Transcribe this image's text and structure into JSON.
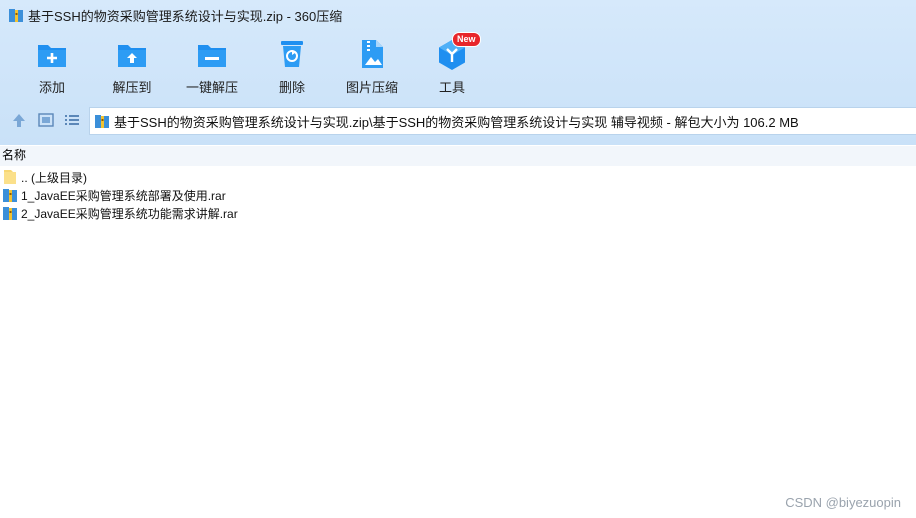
{
  "window": {
    "title": "基于SSH的物资采购管理系统设计与实现.zip - 360压缩"
  },
  "toolbar": {
    "items": [
      {
        "label": "添加",
        "icon": "add-folder-icon"
      },
      {
        "label": "解压到",
        "icon": "extract-to-icon"
      },
      {
        "label": "一键解压",
        "icon": "one-click-extract-icon"
      },
      {
        "label": "删除",
        "icon": "recycle-bin-icon"
      },
      {
        "label": "图片压缩",
        "icon": "image-compress-icon"
      },
      {
        "label": "工具",
        "icon": "tools-icon",
        "badge": "New"
      }
    ]
  },
  "address": {
    "path": "基于SSH的物资采购管理系统设计与实现.zip\\基于SSH的物资采购管理系统设计与实现 辅导视频 - 解包大小为 106.2 MB"
  },
  "list": {
    "header": "名称",
    "rows": [
      {
        "name": ".. (上级目录)",
        "icon": "folder-icon"
      },
      {
        "name": "1_JavaEE采购管理系统部署及使用.rar",
        "icon": "rar-archive-icon"
      },
      {
        "name": "2_JavaEE采购管理系统功能需求讲解.rar",
        "icon": "rar-archive-icon"
      }
    ]
  },
  "watermark": "CSDN @biyezuopin",
  "colors": {
    "accent": "#1f8ff0",
    "toolbar_bg": "#cfe4f9",
    "badge": "#e8262b"
  }
}
